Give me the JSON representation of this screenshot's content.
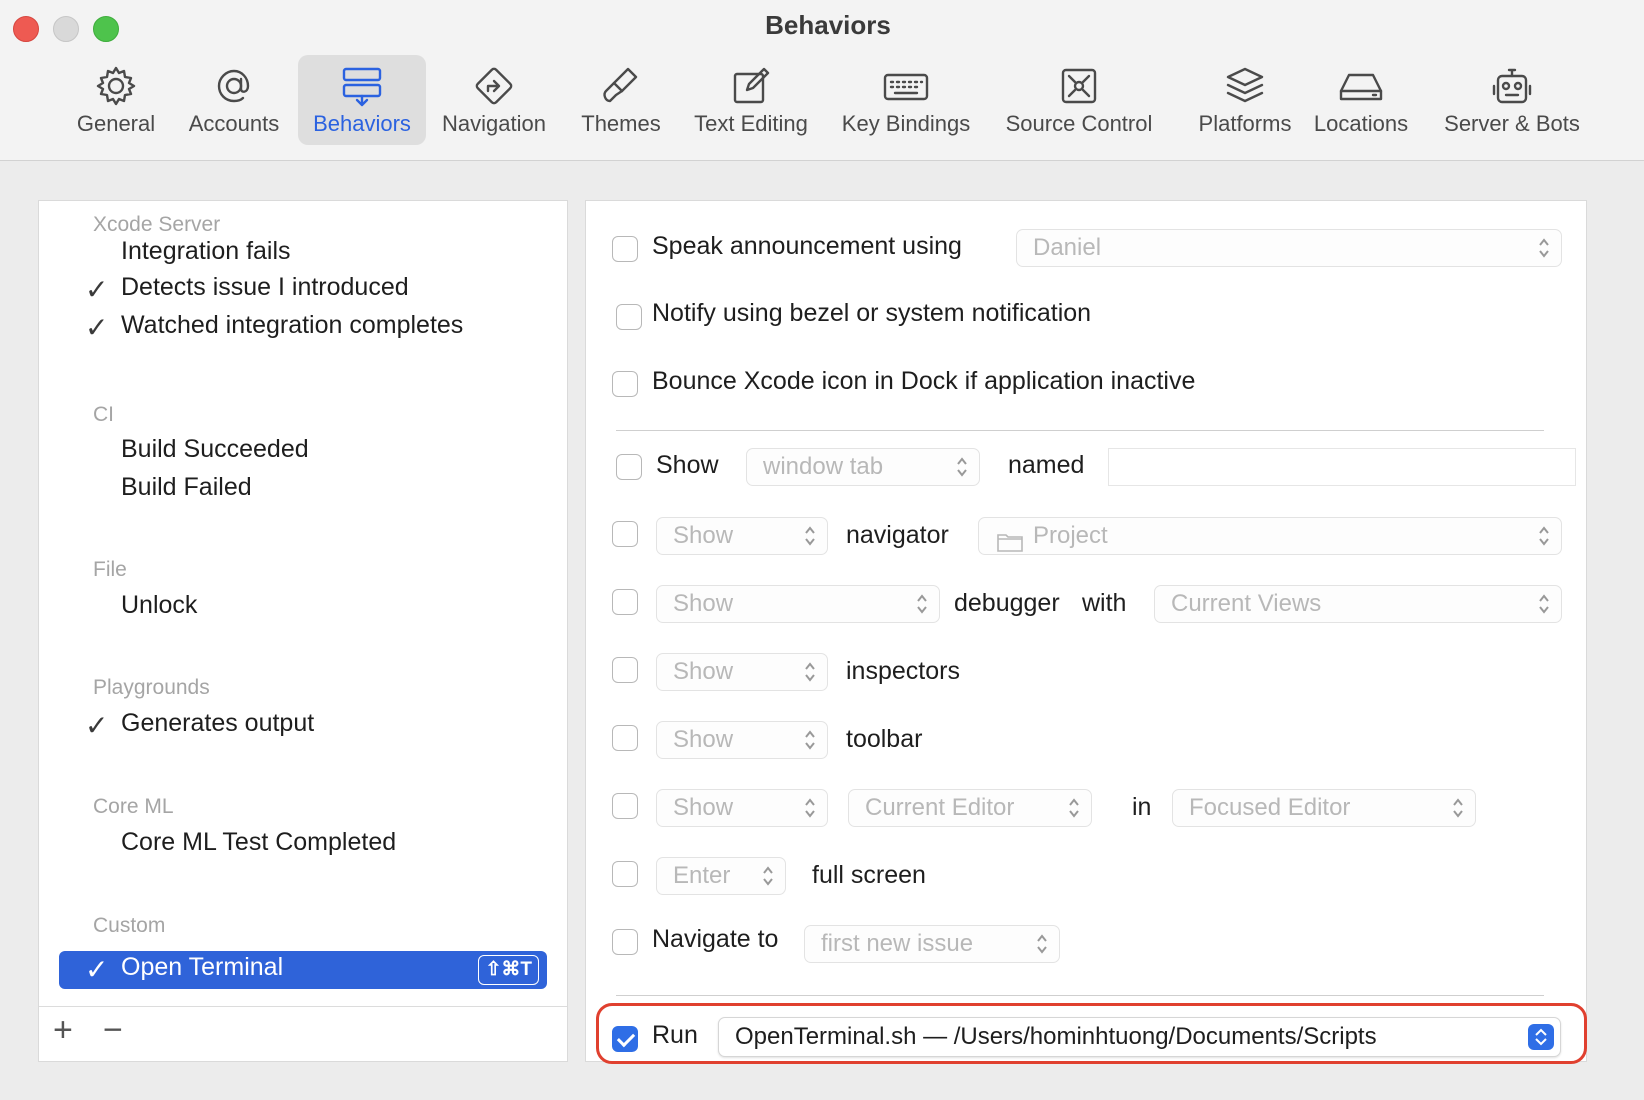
{
  "window": {
    "title": "Behaviors"
  },
  "toolbar": {
    "tabs": [
      {
        "label": "General",
        "icon": "gear-icon"
      },
      {
        "label": "Accounts",
        "icon": "at-icon"
      },
      {
        "label": "Behaviors",
        "icon": "behaviors-icon",
        "active": true
      },
      {
        "label": "Navigation",
        "icon": "navigation-icon"
      },
      {
        "label": "Themes",
        "icon": "brush-icon"
      },
      {
        "label": "Text Editing",
        "icon": "edit-icon"
      },
      {
        "label": "Key Bindings",
        "icon": "keyboard-icon"
      },
      {
        "label": "Source Control",
        "icon": "source-control-icon"
      },
      {
        "label": "Platforms",
        "icon": "layers-icon"
      },
      {
        "label": "Locations",
        "icon": "drive-icon"
      },
      {
        "label": "Server & Bots",
        "icon": "robot-icon"
      }
    ]
  },
  "sidebar": {
    "sections": [
      {
        "header": "Xcode Server",
        "items": [
          {
            "label": "Integration fails",
            "checked": false
          },
          {
            "label": "Detects issue I introduced",
            "checked": true
          },
          {
            "label": "Watched integration completes",
            "checked": true
          }
        ]
      },
      {
        "header": "CI",
        "items": [
          {
            "label": "Build Succeeded",
            "checked": false
          },
          {
            "label": "Build Failed",
            "checked": false
          }
        ]
      },
      {
        "header": "File",
        "items": [
          {
            "label": "Unlock",
            "checked": false
          }
        ]
      },
      {
        "header": "Playgrounds",
        "items": [
          {
            "label": "Generates output",
            "checked": true
          }
        ]
      },
      {
        "header": "Core ML",
        "items": [
          {
            "label": "Core ML Test Completed",
            "checked": false
          }
        ]
      },
      {
        "header": "Custom",
        "items": [
          {
            "label": "Open Terminal",
            "checked": true,
            "selected": true,
            "shortcut": "⇧⌘T"
          }
        ]
      }
    ],
    "footer": {
      "add": "+",
      "remove": "−"
    }
  },
  "behavior": {
    "speak": {
      "label": "Speak announcement using",
      "voice": "Daniel",
      "checked": false
    },
    "notify": {
      "label": "Notify using bezel or system notification",
      "checked": false
    },
    "bounce": {
      "label": "Bounce Xcode icon in Dock if application inactive",
      "checked": false
    },
    "show_tab": {
      "label": "Show",
      "popup": "window tab",
      "named": "named",
      "name_value": "",
      "checked": false
    },
    "navigator": {
      "popup": "Show",
      "label": "navigator",
      "target": "Project",
      "checked": false
    },
    "debugger": {
      "popup": "Show",
      "label": "debugger",
      "with": "with",
      "views": "Current Views",
      "checked": false
    },
    "inspectors": {
      "popup": "Show",
      "label": "inspectors",
      "checked": false
    },
    "toolbar_row": {
      "popup": "Show",
      "label": "toolbar",
      "checked": false
    },
    "editor": {
      "popup": "Show",
      "editor": "Current Editor",
      "in": "in",
      "focused": "Focused Editor",
      "checked": false
    },
    "fullscreen": {
      "popup": "Enter",
      "label": "full screen",
      "checked": false
    },
    "navigate": {
      "label": "Navigate to",
      "popup": "first new issue",
      "checked": false
    },
    "run": {
      "label": "Run",
      "script": "OpenTerminal.sh — /Users/hominhtuong/Documents/Scripts",
      "checked": true
    }
  },
  "colors": {
    "accent": "#2f63d9",
    "highlight": "#e0402f"
  }
}
